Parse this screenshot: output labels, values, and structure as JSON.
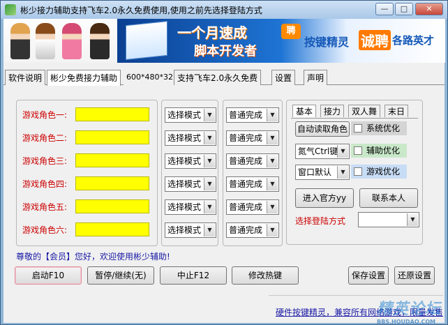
{
  "window": {
    "title": "彬少接力辅助支持飞车2.0永久免费使用,使用之前先选择登陆方式",
    "minimize": "—",
    "maximize": "□",
    "close": "✕"
  },
  "banner": {
    "line1": "一个月速成",
    "line2": "脚本开发者",
    "badge": "聘",
    "text_a": "按键精灵",
    "text_b": "诚聘",
    "text_c": "各路英才"
  },
  "tabs": [
    {
      "label": "软件说明"
    },
    {
      "label": "彬少免费接力辅助"
    },
    {
      "label": "600*480*32"
    },
    {
      "label": "支持飞车2.0永久免费"
    },
    {
      "label": "设置"
    },
    {
      "label": "声明"
    }
  ],
  "roles": [
    {
      "label": "游戏角色一:",
      "mode": "选择模式",
      "finish": "普通完成"
    },
    {
      "label": "游戏角色二:",
      "mode": "选择模式",
      "finish": "普通完成"
    },
    {
      "label": "游戏角色三:",
      "mode": "选择模式",
      "finish": "普通完成"
    },
    {
      "label": "游戏角色四:",
      "mode": "选择模式",
      "finish": "普通完成"
    },
    {
      "label": "游戏角色五:",
      "mode": "选择模式",
      "finish": "普通完成"
    },
    {
      "label": "游戏角色六:",
      "mode": "选择模式",
      "finish": "普通完成"
    }
  ],
  "subtabs": [
    {
      "label": "基本"
    },
    {
      "label": "接力"
    },
    {
      "label": "双人舞"
    },
    {
      "label": "末日"
    }
  ],
  "basic": {
    "auto_read": "自动读取角色",
    "nitro_combo": "氮气Ctrl键",
    "window_combo": "窗口默认",
    "opt_system": "系统优化",
    "opt_assist": "辅助优化",
    "opt_game": "游戏优化",
    "official_site": "进入官方yy",
    "contact": "联系本人",
    "login_label": "选择登陆方式",
    "login_value": ""
  },
  "welcome": "尊敬的【会员】您好，欢迎使用彬少辅助!",
  "buttons": {
    "start": "启动F10",
    "pause": "暂停/继续(无)",
    "stop": "中止F12",
    "hotkey": "修改热键",
    "save": "保存设置",
    "restore": "还原设置"
  },
  "footer": {
    "link": "硬件按键精灵，兼容所有网络游戏，限量发售",
    "watermark_main": "精英论坛",
    "watermark_sub": "BBS.HOUDAO.COM"
  }
}
